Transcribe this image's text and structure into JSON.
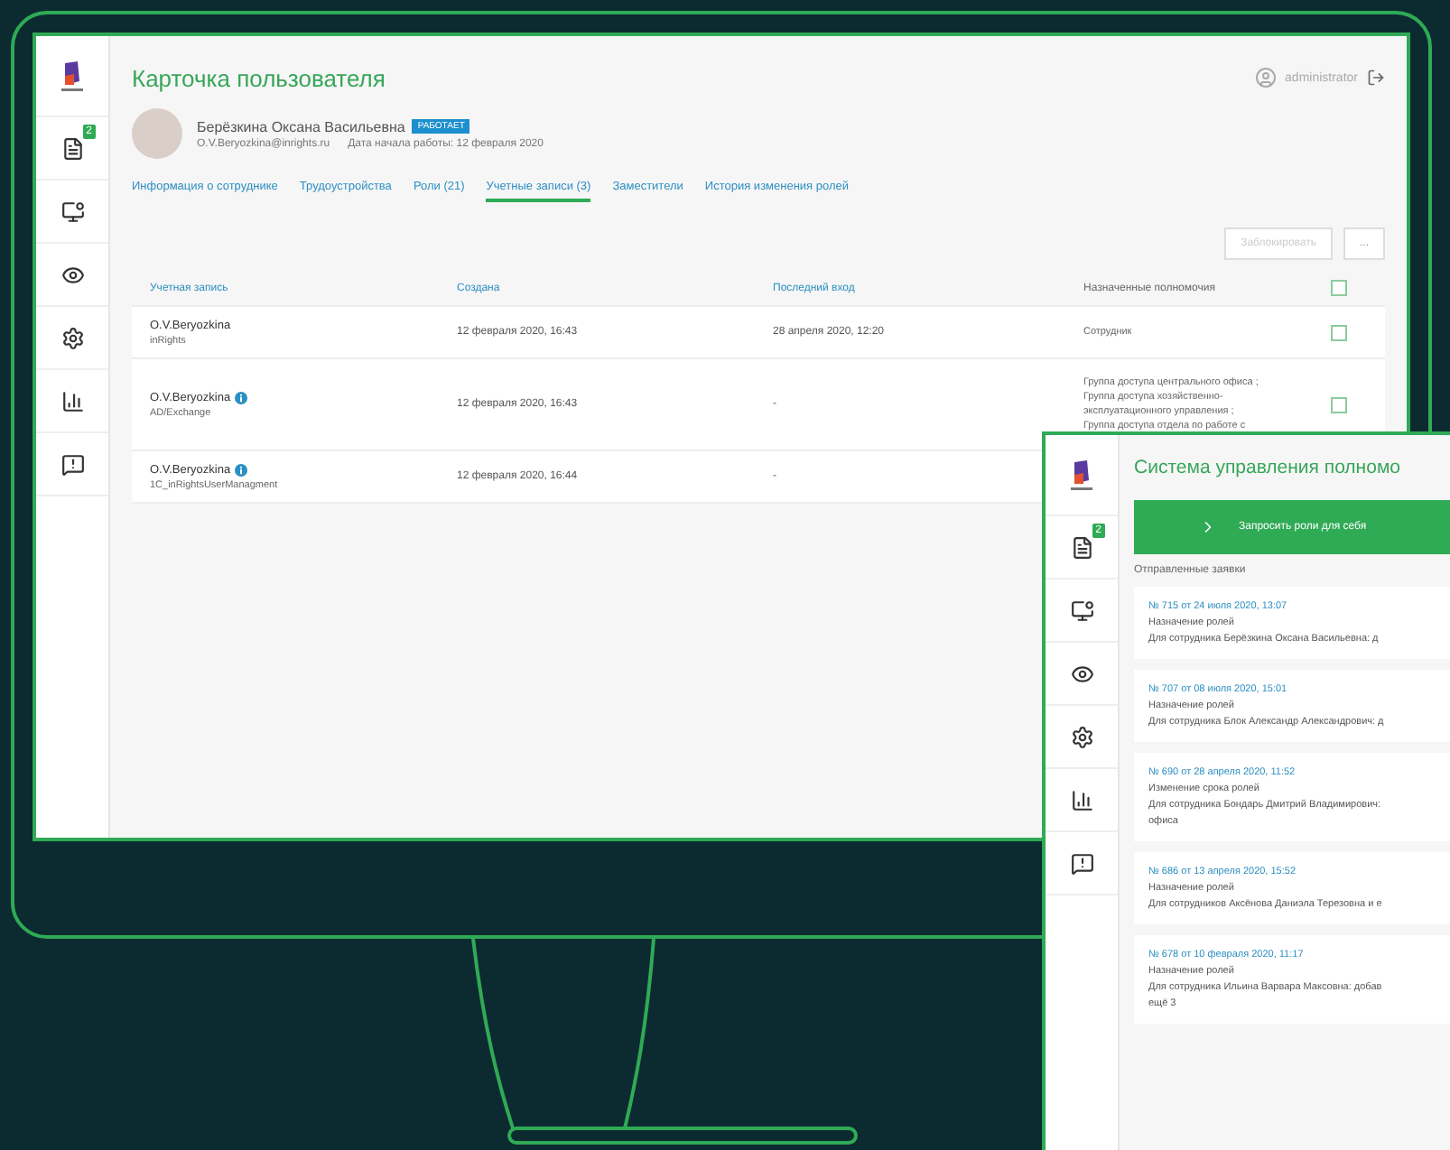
{
  "app": {
    "title": "Карточка пользователя",
    "user": "administrator",
    "badge": "2"
  },
  "profile": {
    "name": "Берёзкина Оксана Васильевна",
    "status": "РАБОТАЕТ",
    "email": "O.V.Beryozkina@inrights.ru",
    "start_date": "Дата начала работы: 12 февраля 2020"
  },
  "tabs": [
    {
      "label": "Информация о сотруднике",
      "selected": false
    },
    {
      "label": "Трудоустройства",
      "selected": false
    },
    {
      "label": "Роли (21)",
      "selected": false
    },
    {
      "label": "Учетные записи (3)",
      "selected": true
    },
    {
      "label": "Заместители",
      "selected": false
    },
    {
      "label": "История изменения ролей",
      "selected": false
    }
  ],
  "actions": [
    {
      "label": "Заблокировать",
      "disabled": true
    },
    {
      "label": "...",
      "disabled": false
    }
  ],
  "table": {
    "columns": [
      "Учетная запись",
      "Создана",
      "Последний вход",
      "Назначенные полномочия"
    ],
    "header_checked": false,
    "rows": [
      {
        "account": "O.V.Beryozkina",
        "source": "inRights",
        "info": false,
        "created": "12 февраля 2020, 16:43",
        "last_login": "28 апреля 2020, 12:20",
        "authorities": [
          "Сотрудник"
        ],
        "checked": false
      },
      {
        "account": "O.V.Beryozkina",
        "source": "AD/Exchange",
        "info": true,
        "created": "12 февраля 2020, 16:43",
        "last_login": "-",
        "authorities": [
          "Группа доступа центрального офиса ;",
          "Группа доступа хозяйственно-",
          "эксплуатационного управления ;",
          "Группа доступа отдела по работе с"
        ],
        "checked": false
      },
      {
        "account": "O.V.Beryozkina",
        "source": "1C_inRightsUserManagment",
        "info": true,
        "created": "12 февраля 2020, 16:44",
        "last_login": "-"
      }
    ]
  },
  "requests_panel": {
    "title": "Система управления полномо",
    "badge": "2",
    "request_button": "Запросить роли для себя",
    "section": "Отправленные заявки",
    "requests": [
      {
        "number": "№ 715 от 24 июля 2020, 13:07",
        "type": "Назначение ролей",
        "description": [
          "Для сотрудника Берёзкина Оксана Васильевна: д"
        ]
      },
      {
        "number": "№ 707 от 08 июля 2020, 15:01",
        "type": "Назначение ролей",
        "description": [
          "Для сотрудника Блок Александр Александрович: д"
        ]
      },
      {
        "number": "№ 690 от 28 апреля 2020, 11:52",
        "type": "Изменение срока ролей",
        "description": [
          "Для сотрудника Бондарь Дмитрий Владимирович:",
          "офиса"
        ]
      },
      {
        "number": "№ 686 от 13 апреля 2020, 15:52",
        "type": "Назначение ролей",
        "description": [
          "Для сотрудников Аксёнова Даниэла Терезовна и е"
        ]
      },
      {
        "number": "№ 678 от 10 февраля 2020, 11:17",
        "type": "Назначение ролей",
        "description": [
          "Для сотрудника Ильина Варвара Максовна: добав",
          "ещё 3"
        ]
      }
    ]
  }
}
